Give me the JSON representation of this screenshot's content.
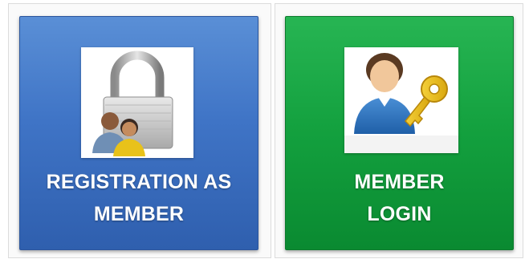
{
  "tiles": {
    "register": {
      "label_line1": "REGISTRATION AS",
      "label_line2": "MEMBER",
      "icon": "padlock-users-icon",
      "color": "#3f74c6"
    },
    "login": {
      "label_line1": "MEMBER",
      "label_line2": "LOGIN",
      "icon": "user-key-icon",
      "color": "#13a03e"
    }
  }
}
